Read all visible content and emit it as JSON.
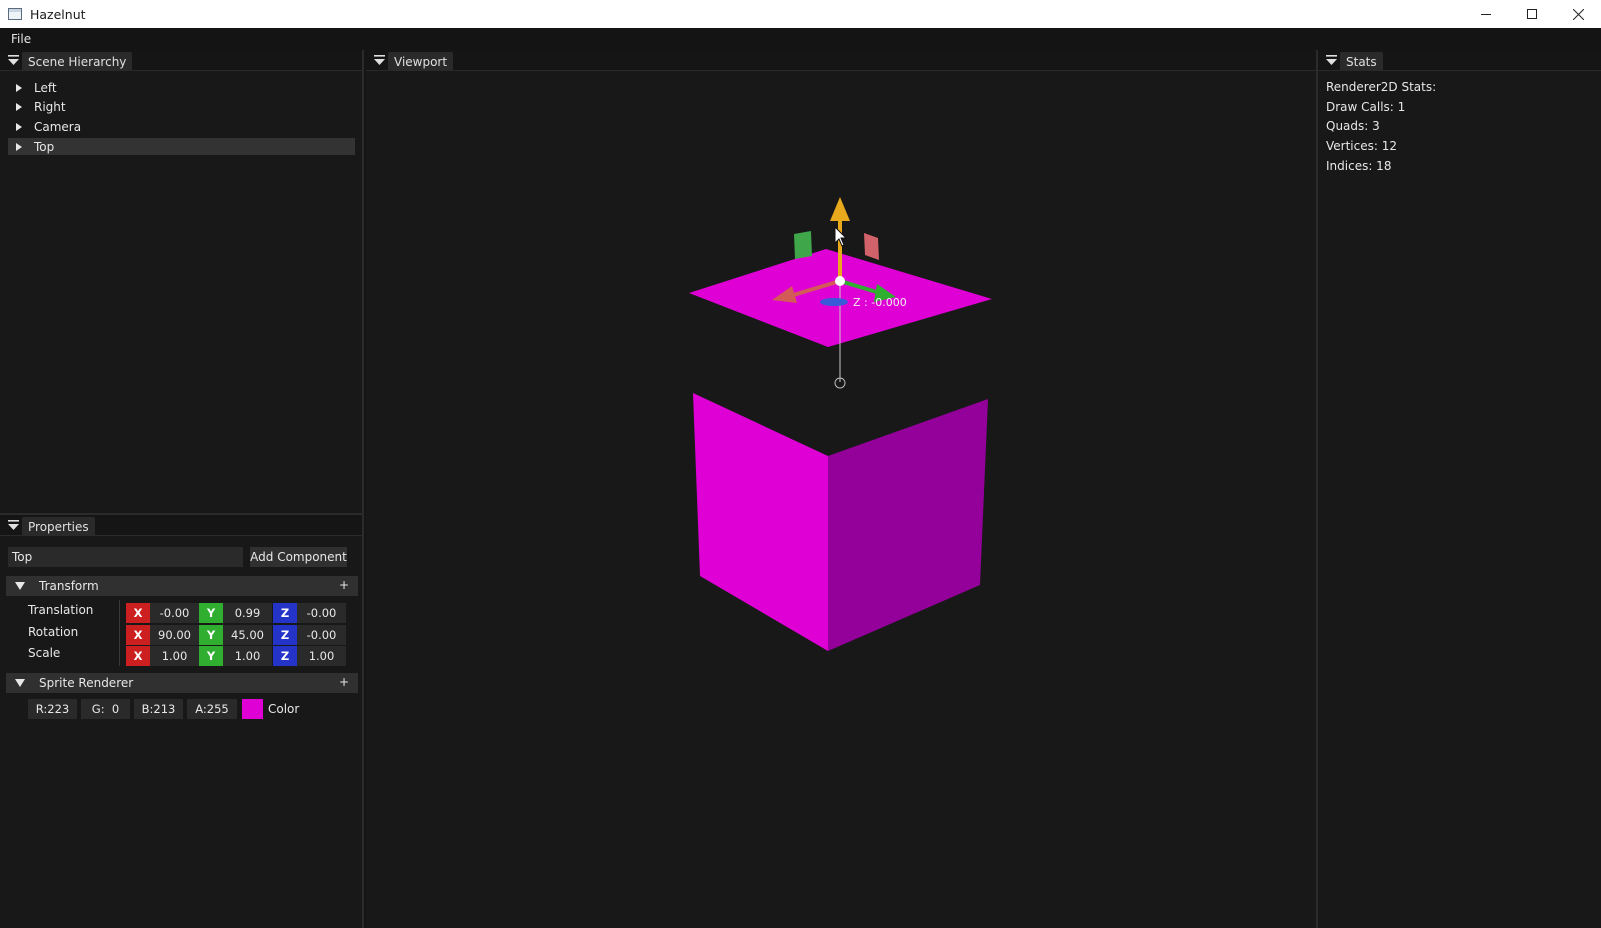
{
  "window": {
    "title": "Hazelnut"
  },
  "menu": {
    "file": "File"
  },
  "hierarchy": {
    "title": "Scene Hierarchy",
    "items": [
      {
        "label": "Left"
      },
      {
        "label": "Right"
      },
      {
        "label": "Camera"
      },
      {
        "label": "Top",
        "selected": true
      }
    ]
  },
  "viewport": {
    "title": "Viewport",
    "gizmo_readout": "Z : -0.000",
    "colors": {
      "sprite": "#df00d5",
      "sprite_shade": "#93009a"
    }
  },
  "stats": {
    "title": "Stats",
    "heading": "Renderer2D Stats:",
    "draw_calls": "Draw Calls: 1",
    "quads": "Quads: 3",
    "vertices": "Vertices: 12",
    "indices": "Indices: 18"
  },
  "properties": {
    "title": "Properties",
    "name_value": "Top",
    "add_component": "Add Component",
    "transform": {
      "title": "Transform",
      "plus": "+",
      "translation": {
        "label": "Translation",
        "x": "-0.00",
        "y": "0.99",
        "z": "-0.00"
      },
      "rotation": {
        "label": "Rotation",
        "x": "90.00",
        "y": "45.00",
        "z": "-0.00"
      },
      "scale": {
        "label": "Scale",
        "x": "1.00",
        "y": "1.00",
        "z": "1.00"
      },
      "axis_x": "X",
      "axis_y": "Y",
      "axis_z": "Z"
    },
    "sprite_renderer": {
      "title": "Sprite Renderer",
      "plus": "+",
      "r": "R:223",
      "g": "G:  0",
      "b": "B:213",
      "a": "A:255",
      "color_label": "Color",
      "color_hex": "#df00d5"
    }
  }
}
